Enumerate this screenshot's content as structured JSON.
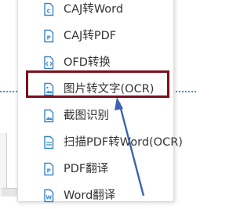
{
  "menu": {
    "items": [
      {
        "label": "CAJ转Word",
        "icon": "caj-document-icon"
      },
      {
        "label": "CAJ转PDF",
        "icon": "pdf-document-icon"
      },
      {
        "label": "OFD转换",
        "icon": "ofd-code-icon"
      },
      {
        "label": "图片转文字(OCR)",
        "icon": "image-document-icon"
      },
      {
        "label": "截图识别",
        "icon": "screenshot-icon"
      },
      {
        "label": "扫描PDF转Word(OCR)",
        "icon": "scan-document-icon"
      },
      {
        "label": "PDF翻译",
        "icon": "translate-document-icon"
      },
      {
        "label": "Word翻译",
        "icon": "word-document-icon"
      }
    ]
  },
  "colors": {
    "icon_blue": "#3a86c8",
    "highlight_border": "#7a0f1c",
    "dotted_line": "#3f8fd8",
    "arrow": "#3b63b0"
  }
}
